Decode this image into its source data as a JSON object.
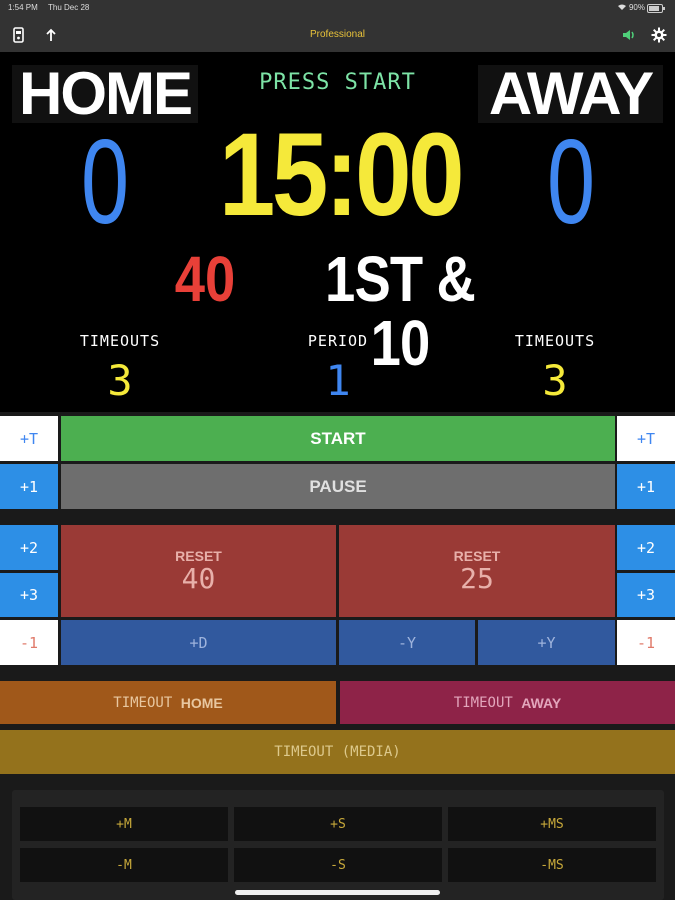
{
  "status_bar": {
    "time": "1:54 PM",
    "date": "Thu Dec 28",
    "battery": "90%"
  },
  "toolbar": {
    "title": "Professional",
    "icons": [
      "remote-icon",
      "share-icon",
      "sound-icon",
      "gear-icon"
    ]
  },
  "scoreboard": {
    "home_label": "HOME",
    "away_label": "AWAY",
    "status": "PRESS START",
    "home_score": "0",
    "away_score": "0",
    "clock": "15:00",
    "yards_to_go": "40",
    "down_distance": "1ST & 10",
    "timeouts_label_home": "TIMEOUTS",
    "timeouts_label_away": "TIMEOUTS",
    "period_label": "PERIOD",
    "home_timeouts": "3",
    "period": "1",
    "away_timeouts": "3"
  },
  "controls": {
    "home_plus_t": "+T",
    "away_plus_t": "+T",
    "start": "START",
    "pause": "PAUSE",
    "home_plus_1": "+1",
    "away_plus_1": "+1",
    "home_plus_2": "+2",
    "away_plus_2": "+2",
    "home_plus_3": "+3",
    "away_plus_3": "+3",
    "home_minus_1": "-1",
    "away_minus_1": "-1",
    "reset_label": "RESET",
    "reset_40": "40",
    "reset_25": "25",
    "plus_d": "+D",
    "minus_y": "-Y",
    "plus_y": "+Y",
    "timeout_home_prefix": "TIMEOUT",
    "timeout_home_team": "HOME",
    "timeout_away_prefix": "TIMEOUT",
    "timeout_away_team": "AWAY",
    "timeout_media": "TIMEOUT (MEDIA)"
  },
  "clock_adjust": {
    "plus_m": "+M",
    "plus_s": "+S",
    "plus_ms": "+MS",
    "minus_m": "-M",
    "minus_s": "-S",
    "minus_ms": "-MS"
  },
  "colors": {
    "home_score": "#3f86f0",
    "clock": "#f5e93a",
    "yards": "#e84038",
    "start": "#4caf50",
    "pause": "#6e6e6e",
    "reset": "#9a3a36",
    "adjust": "#31599e",
    "timeout_home": "#a0581a",
    "timeout_away": "#8e2348",
    "timeout_media": "#94721c"
  }
}
